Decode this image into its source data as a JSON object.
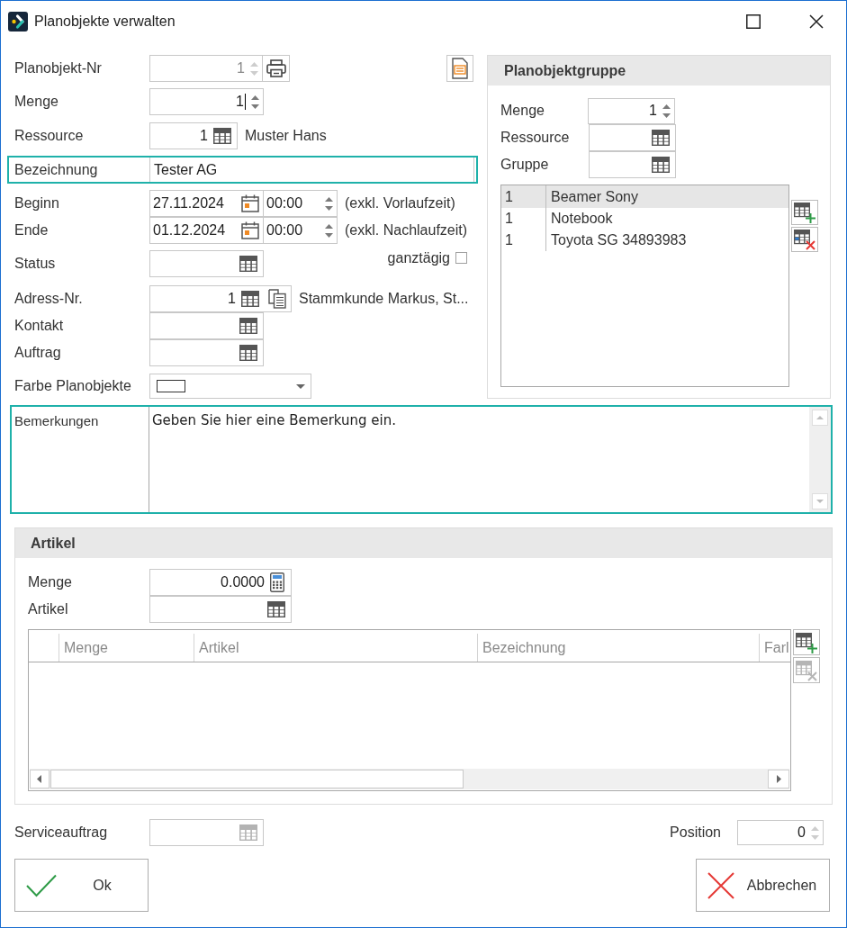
{
  "window": {
    "title": "Planobjekte verwalten"
  },
  "form": {
    "planobjekt_nr": {
      "label": "Planobjekt-Nr",
      "value": "1",
      "disabled": true
    },
    "menge": {
      "label": "Menge",
      "value": "1",
      "focused": true
    },
    "ressource": {
      "label": "Ressource",
      "value": "1",
      "name": "Muster Hans"
    },
    "bezeichnung": {
      "label": "Bezeichnung",
      "value": "Tester AG",
      "highlighted": true
    },
    "beginn": {
      "label": "Beginn",
      "date": "27.11.2024",
      "time": "00:00",
      "note": "(exkl. Vorlaufzeit)"
    },
    "ende": {
      "label": "Ende",
      "date": "01.12.2024",
      "time": "00:00",
      "note": "(exkl. Nachlaufzeit)"
    },
    "ganztaegig": {
      "label": "ganztägig",
      "checked": false
    },
    "status": {
      "label": "Status"
    },
    "adress_nr": {
      "label": "Adress-Nr.",
      "value": "1",
      "name": "Stammkunde Markus, St..."
    },
    "kontakt": {
      "label": "Kontakt"
    },
    "auftrag": {
      "label": "Auftrag"
    },
    "farbe": {
      "label": "Farbe Planobjekte",
      "color": "#ffffff"
    }
  },
  "planobjektgruppe": {
    "title": "Planobjektgruppe",
    "menge": {
      "label": "Menge",
      "value": "1"
    },
    "ressource": {
      "label": "Ressource"
    },
    "gruppe": {
      "label": "Gruppe"
    },
    "rows": [
      {
        "column_1": "1",
        "column_2": "Beamer Sony",
        "selected": true
      },
      {
        "column_1": "1",
        "column_2": "Notebook",
        "selected": false
      },
      {
        "column_1": "1",
        "column_2": "Toyota SG 34893983",
        "selected": false
      }
    ],
    "remove_disabled": false
  },
  "bemerkungen": {
    "label": "Bemerkungen",
    "value": "Geben Sie hier eine Bemerkung ein.",
    "highlighted": true
  },
  "artikel": {
    "title": "Artikel",
    "menge": {
      "label": "Menge",
      "value": "0.0000"
    },
    "artikel": {
      "label": "Artikel"
    },
    "table": {
      "columns": [
        "Menge",
        "Artikel",
        "Bezeichnung",
        "Farl"
      ]
    },
    "remove_disabled": true
  },
  "serviceauftrag": {
    "label": "Serviceauftrag",
    "disabled": true
  },
  "position": {
    "label": "Position",
    "value": "0"
  },
  "buttons": [
    {
      "kind": "ok",
      "label": "Ok"
    },
    {
      "kind": "cancel",
      "label": "Abbrechen"
    }
  ]
}
